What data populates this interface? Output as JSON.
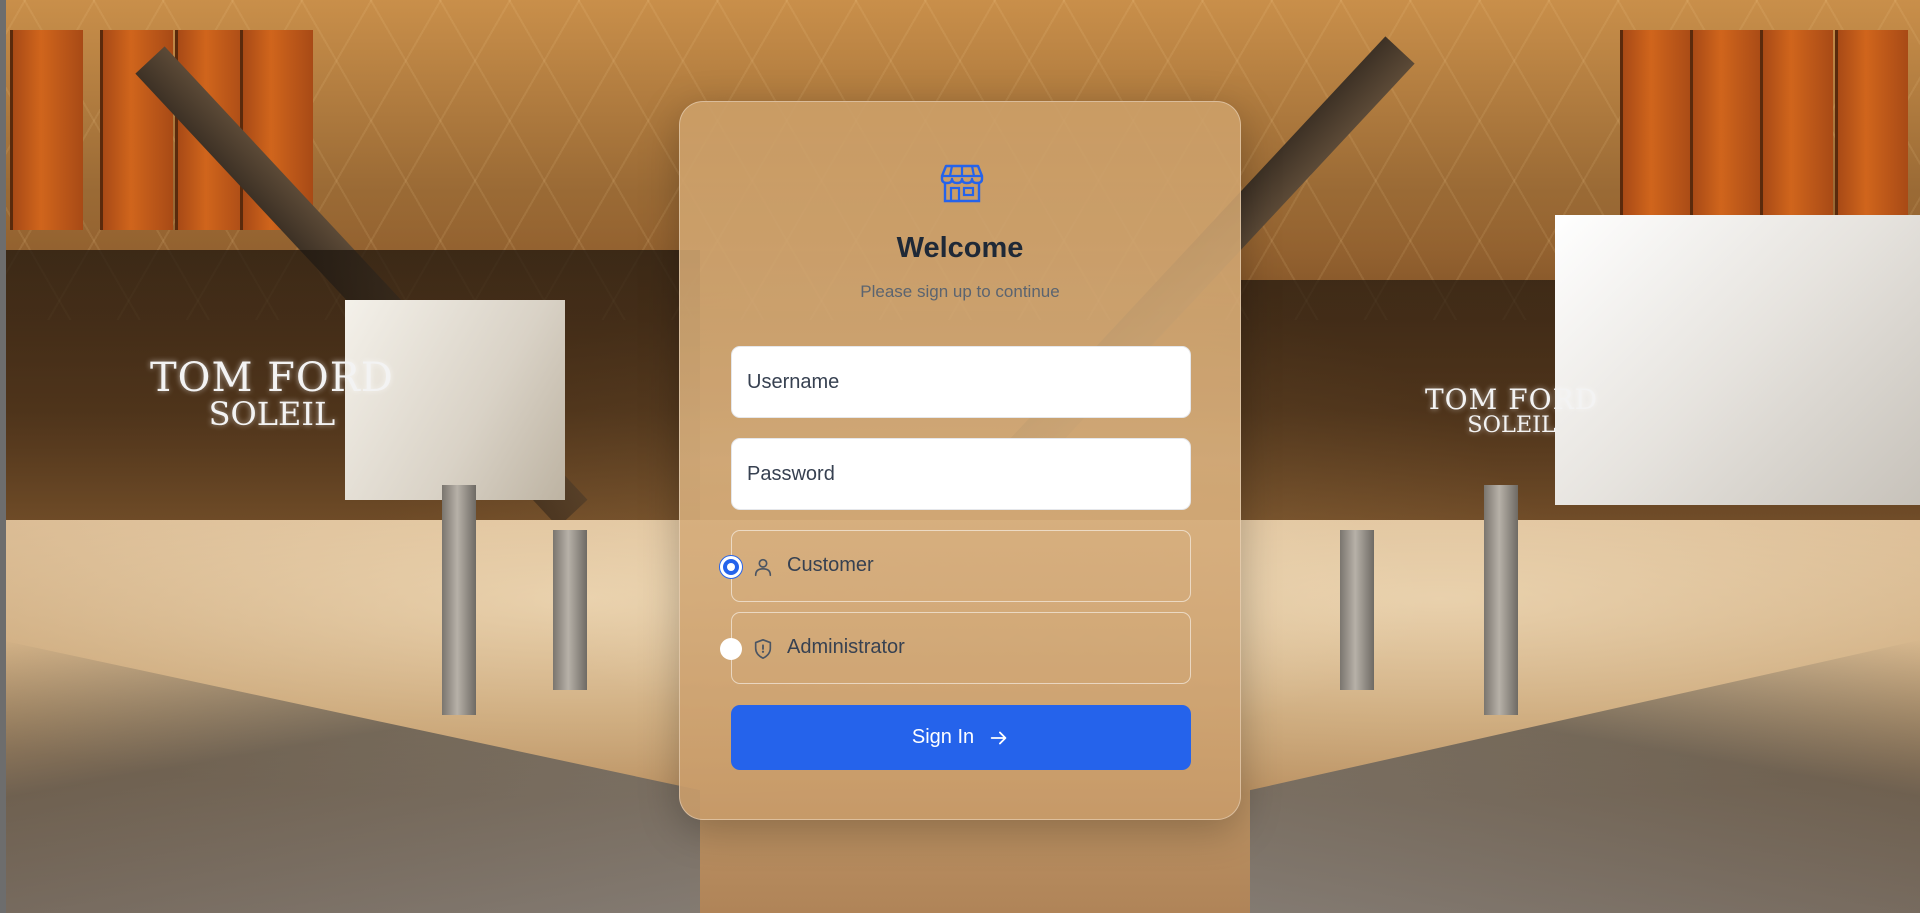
{
  "background": {
    "signs": {
      "left": {
        "line1": "TOM FORD",
        "line2": "SOLEIL"
      },
      "right": {
        "line1": "TOM FORD",
        "line2": "SOLEIL"
      }
    }
  },
  "card": {
    "logo_icon": "store-icon",
    "title": "Welcome",
    "subtitle": "Please sign up to continue",
    "username": {
      "placeholder": "Username",
      "value": ""
    },
    "password": {
      "placeholder": "Password",
      "value": ""
    },
    "roles": [
      {
        "label": "Customer",
        "icon": "user-icon",
        "selected": true
      },
      {
        "label": "Administrator",
        "icon": "shield-icon",
        "selected": false
      }
    ],
    "submit": {
      "label": "Sign In",
      "icon": "arrow-right-icon"
    }
  },
  "colors": {
    "accent": "#2563eb",
    "title": "#1f2937",
    "subtitle": "#5b6470"
  }
}
